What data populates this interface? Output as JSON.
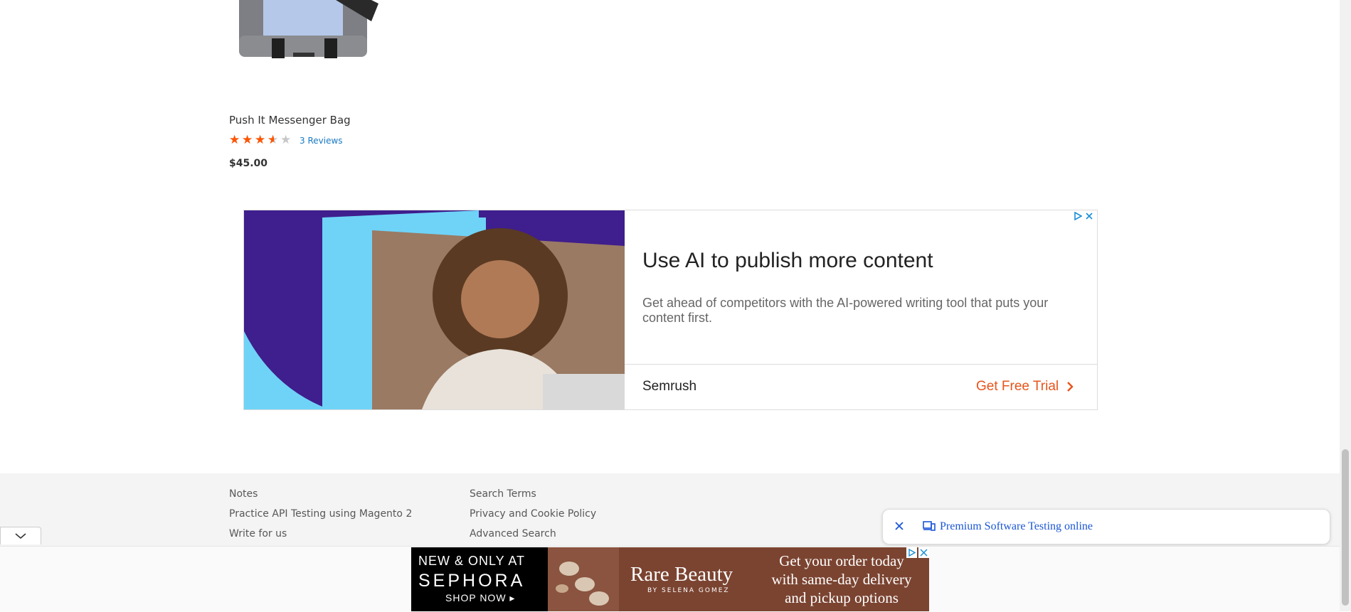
{
  "product": {
    "name": "Push It Messenger Bag",
    "rating": 3.5,
    "rating_max": 5,
    "reviews_label": "3 Reviews",
    "price": "$45.00"
  },
  "ad": {
    "headline": "Use AI to publish more content",
    "body": "Get ahead of competitors with the AI-powered writing tool that puts your content first.",
    "brand": "Semrush",
    "cta": "Get Free Trial",
    "colors": {
      "purple": "#3f1e8d",
      "cyan": "#6fd3f7",
      "cta": "#e7541a"
    }
  },
  "footer": {
    "col1": [
      "Notes",
      "Practice API Testing using Magento 2",
      "Write for us"
    ],
    "col2": [
      "Search Terms",
      "Privacy and Cookie Policy",
      "Advanced Search"
    ]
  },
  "premium_bar": {
    "label": "Premium Software Testing online"
  },
  "banner": {
    "line1": "NEW & ONLY AT",
    "brand": "SEPHORA",
    "shop": "SHOP NOW ▸",
    "product_brand": "Rare Beauty",
    "product_sub": "BY SELENA GOMEZ",
    "promo": [
      "Get your order today",
      "with same-day delivery",
      "and pickup options"
    ]
  }
}
